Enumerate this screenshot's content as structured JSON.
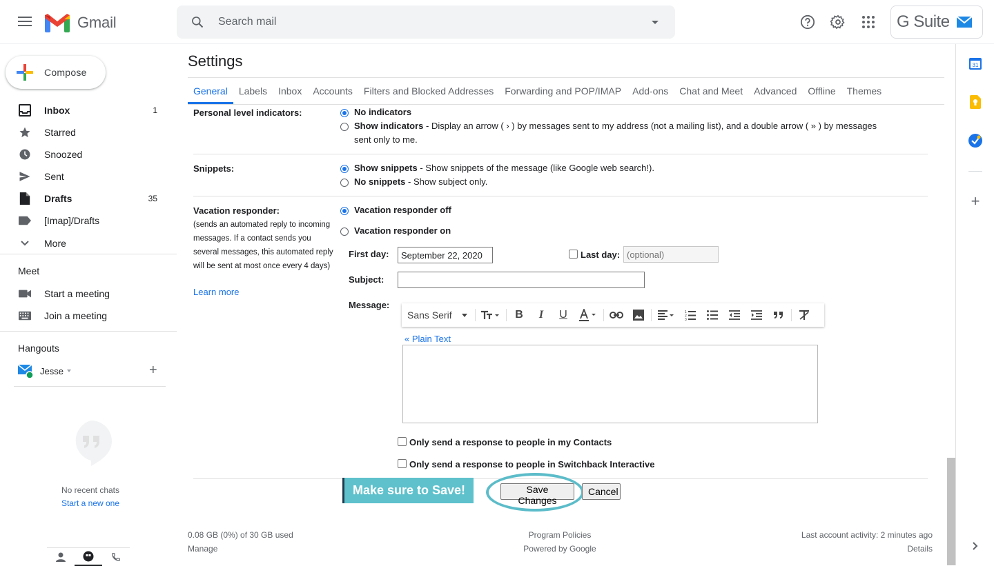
{
  "header": {
    "product_name": "Gmail",
    "search_placeholder": "Search mail",
    "gsuite_label": "G Suite"
  },
  "compose": {
    "label": "Compose"
  },
  "nav": [
    {
      "label": "Inbox",
      "count": "1",
      "bold": true,
      "icon": "inbox-icon"
    },
    {
      "label": "Starred",
      "count": "",
      "icon": "star-icon"
    },
    {
      "label": "Snoozed",
      "count": "",
      "icon": "clock-icon"
    },
    {
      "label": "Sent",
      "count": "",
      "icon": "send-icon"
    },
    {
      "label": "Drafts",
      "count": "35",
      "bold": true,
      "icon": "draft-icon"
    },
    {
      "label": "[Imap]/Drafts",
      "count": "",
      "icon": "label-icon"
    },
    {
      "label": "More",
      "count": "",
      "icon": "chevron-down-icon"
    }
  ],
  "meet": {
    "title": "Meet",
    "items": [
      {
        "label": "Start a meeting",
        "icon": "video-icon"
      },
      {
        "label": "Join a meeting",
        "icon": "keyboard-icon"
      }
    ]
  },
  "hangouts": {
    "title": "Hangouts",
    "user": "Jesse",
    "no_chats": "No recent chats",
    "start_new": "Start a new one"
  },
  "settings": {
    "title": "Settings",
    "tabs": [
      "General",
      "Labels",
      "Inbox",
      "Accounts",
      "Filters and Blocked Addresses",
      "Forwarding and POP/IMAP",
      "Add-ons",
      "Chat and Meet",
      "Advanced",
      "Offline",
      "Themes"
    ],
    "active_tab": "General",
    "personal": {
      "label": "Personal level indicators:",
      "opt1": "No indicators",
      "opt2_title": "Show indicators",
      "opt2_desc": " - Display an arrow ( › ) by messages sent to my address (not a mailing list), and a double arrow ( » ) by messages",
      "opt2_desc2": "sent only to me."
    },
    "snippets": {
      "label": "Snippets:",
      "opt1_title": "Show snippets",
      "opt1_desc": " - Show snippets of the message (like Google web search!).",
      "opt2_title": "No snippets",
      "opt2_desc": " - Show subject only."
    },
    "vacation": {
      "label": "Vacation responder:",
      "note": "(sends an automated reply to incoming messages. If a contact sends you several messages, this automated reply will be sent at most once every 4 days)",
      "learn_more": "Learn more",
      "off": "Vacation responder off",
      "on": "Vacation responder on",
      "first_day_label": "First day:",
      "first_day_value": "September 22, 2020",
      "last_day_label": "Last day:",
      "last_day_placeholder": "(optional)",
      "subject_label": "Subject:",
      "subject_value": "",
      "message_label": "Message:",
      "font": "Sans Serif",
      "plain_text": "« Plain Text",
      "contacts_only": "Only send a response to people in my Contacts",
      "org_only": "Only send a response to people in Switchback Interactive"
    },
    "banner": "Make sure to Save!",
    "save_label": "Save Changes",
    "cancel_label": "Cancel"
  },
  "footer": {
    "storage": "0.08 GB (0%) of 30 GB used",
    "manage": "Manage",
    "program_policies": "Program Policies",
    "powered_by": "Powered by Google",
    "last_activity": "Last account activity: 2 minutes ago",
    "details": "Details"
  },
  "colors": {
    "accent": "#1a73e8",
    "annotation": "#5ec1cc"
  }
}
